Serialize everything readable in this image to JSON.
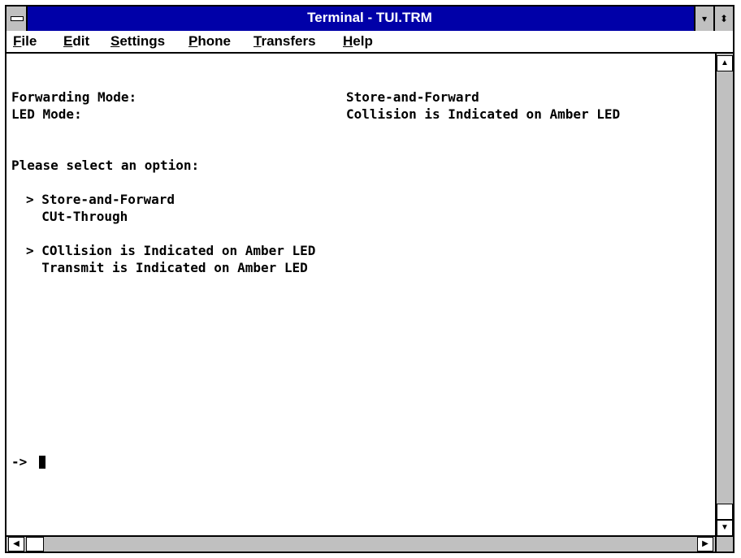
{
  "window": {
    "title": "Terminal - TUI.TRM",
    "minimize_glyph": "▾",
    "maximize_glyph": "⬍"
  },
  "menu": {
    "items": [
      "File",
      "Edit",
      "Settings",
      "Phone",
      "Transfers",
      "Help"
    ]
  },
  "terminal": {
    "forwarding_label": "Forwarding Mode:",
    "forwarding_value": "Store-and-Forward",
    "led_label": "LED Mode:",
    "led_value": "Collision is Indicated on Amber LED",
    "prompt_text": "Please select an option:",
    "forwarding_options": [
      "> Store-and-Forward",
      "  CUt-Through"
    ],
    "led_options": [
      "> COllision is Indicated on Amber LED",
      "  Transmit is Indicated on Amber LED"
    ],
    "command_prompt": "->"
  },
  "scrollbars": {
    "up_glyph": "▲",
    "down_glyph": "▼",
    "left_glyph": "◀",
    "right_glyph": "▶"
  }
}
